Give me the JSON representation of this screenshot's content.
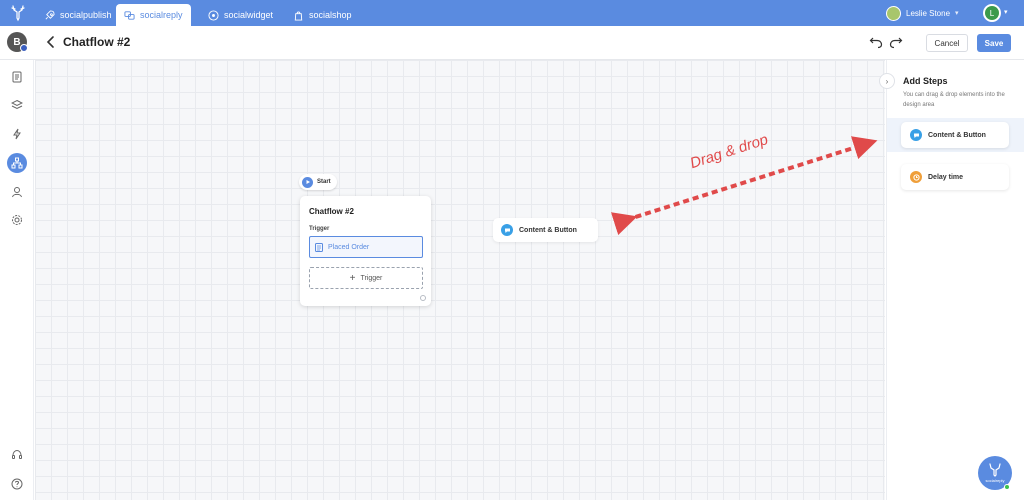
{
  "nav": {
    "tabs": [
      {
        "label": "socialpublish",
        "icon": "rocket-icon"
      },
      {
        "label": "socialreply",
        "icon": "chat-bubbles-icon"
      },
      {
        "label": "socialwidget",
        "icon": "widget-icon"
      },
      {
        "label": "socialshop",
        "icon": "shopping-bag-icon"
      }
    ],
    "active_tab": "socialreply",
    "user_name": "Leslie Stone",
    "account_initial": "L"
  },
  "header": {
    "title": "Chatflow #2",
    "cancel_label": "Cancel",
    "save_label": "Save"
  },
  "sidebar": {
    "avatar_initial": "B",
    "items": [
      "document-icon",
      "layers-icon",
      "lightning-icon",
      "flow-icon",
      "user-icon",
      "settings-icon"
    ],
    "active_item": "flow-icon",
    "bottom_items": [
      "support-icon",
      "help-icon"
    ]
  },
  "canvas": {
    "start_label": "Start",
    "flow_card": {
      "title": "Chatflow #2",
      "trigger_label": "Trigger",
      "trigger_item": "Placed Order",
      "add_trigger_label": "Trigger"
    },
    "drag_chip_label": "Content & Button",
    "annotation": "Drag & drop",
    "annotation_color": "#e04a4a"
  },
  "panel": {
    "title": "Add Steps",
    "description": "You can drag & drop elements into the design area",
    "steps": [
      {
        "label": "Content & Button",
        "icon": "chat-icon",
        "color": "#39a0e6"
      },
      {
        "label": "Delay time",
        "icon": "clock-icon",
        "color": "#ef9f3a"
      }
    ]
  },
  "fab": {
    "label": "socialreply"
  },
  "colors": {
    "brand": "#5a8be0",
    "accent_red": "#e04a4a",
    "online": "#3cc24e"
  }
}
